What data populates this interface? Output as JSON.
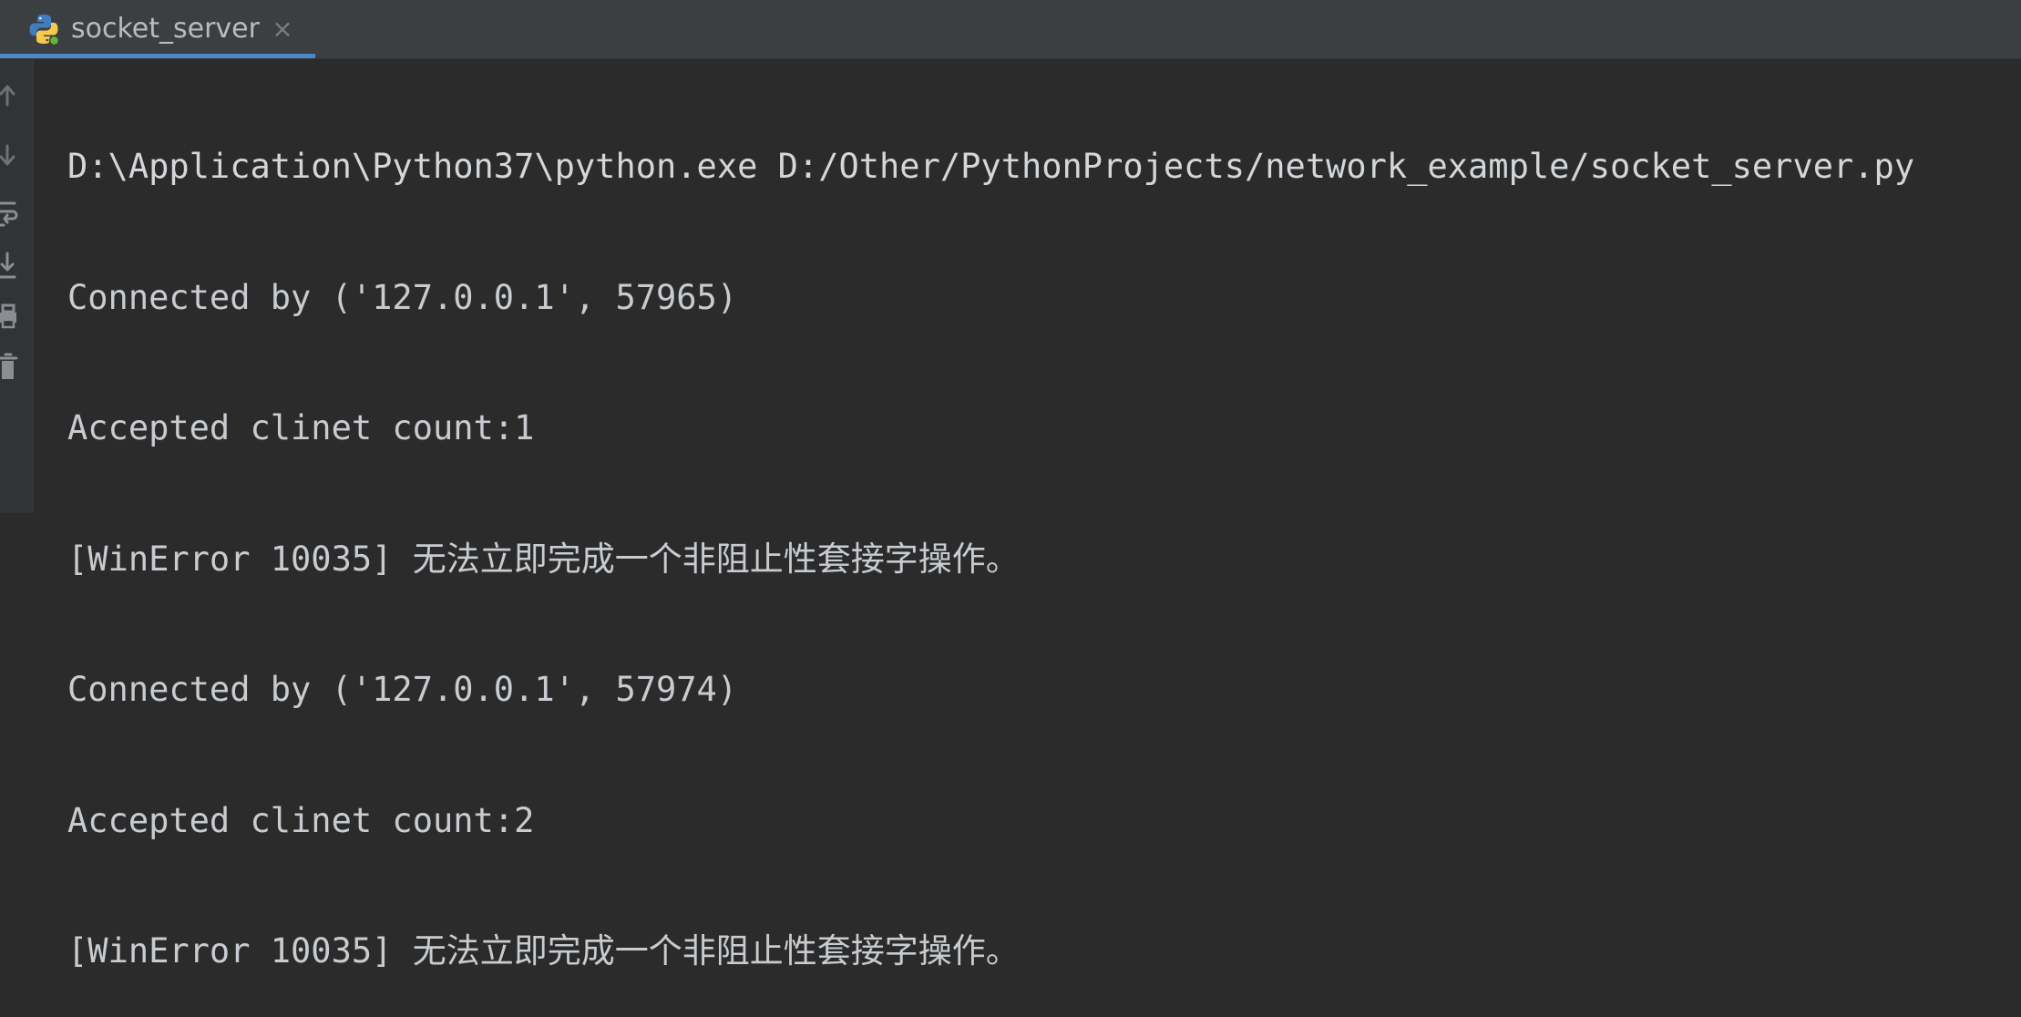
{
  "tab": {
    "title": "socket_server",
    "close_glyph": "×",
    "icon": "python-icon"
  },
  "toolbar": {
    "buttons": [
      {
        "icon": "up-arrow-icon",
        "label": "Up"
      },
      {
        "icon": "down-arrow-icon",
        "label": "Down"
      },
      {
        "icon": "soft-wrap-icon",
        "label": "Soft-wrap"
      },
      {
        "icon": "scroll-to-end-icon",
        "label": "Scroll to end"
      },
      {
        "icon": "print-icon",
        "label": "Print"
      },
      {
        "icon": "trash-icon",
        "label": "Clear all"
      }
    ]
  },
  "console": {
    "lines": [
      "D:\\Application\\Python37\\python.exe D:/Other/PythonProjects/network_example/socket_server.py",
      "Connected by ('127.0.0.1', 57965)",
      "Accepted clinet count:1",
      "[WinError 10035] 无法立即完成一个非阻止性套接字操作。",
      "Connected by ('127.0.0.1', 57974)",
      "Accepted clinet count:2",
      "[WinError 10035] 无法立即完成一个非阻止性套接字操作。"
    ]
  },
  "colors": {
    "background": "#2b2b2b",
    "tabbar": "#3c3f41",
    "tab_underline": "#4a88c7",
    "text": "#c8ccd0",
    "gutter_icon": "#6e7275"
  }
}
